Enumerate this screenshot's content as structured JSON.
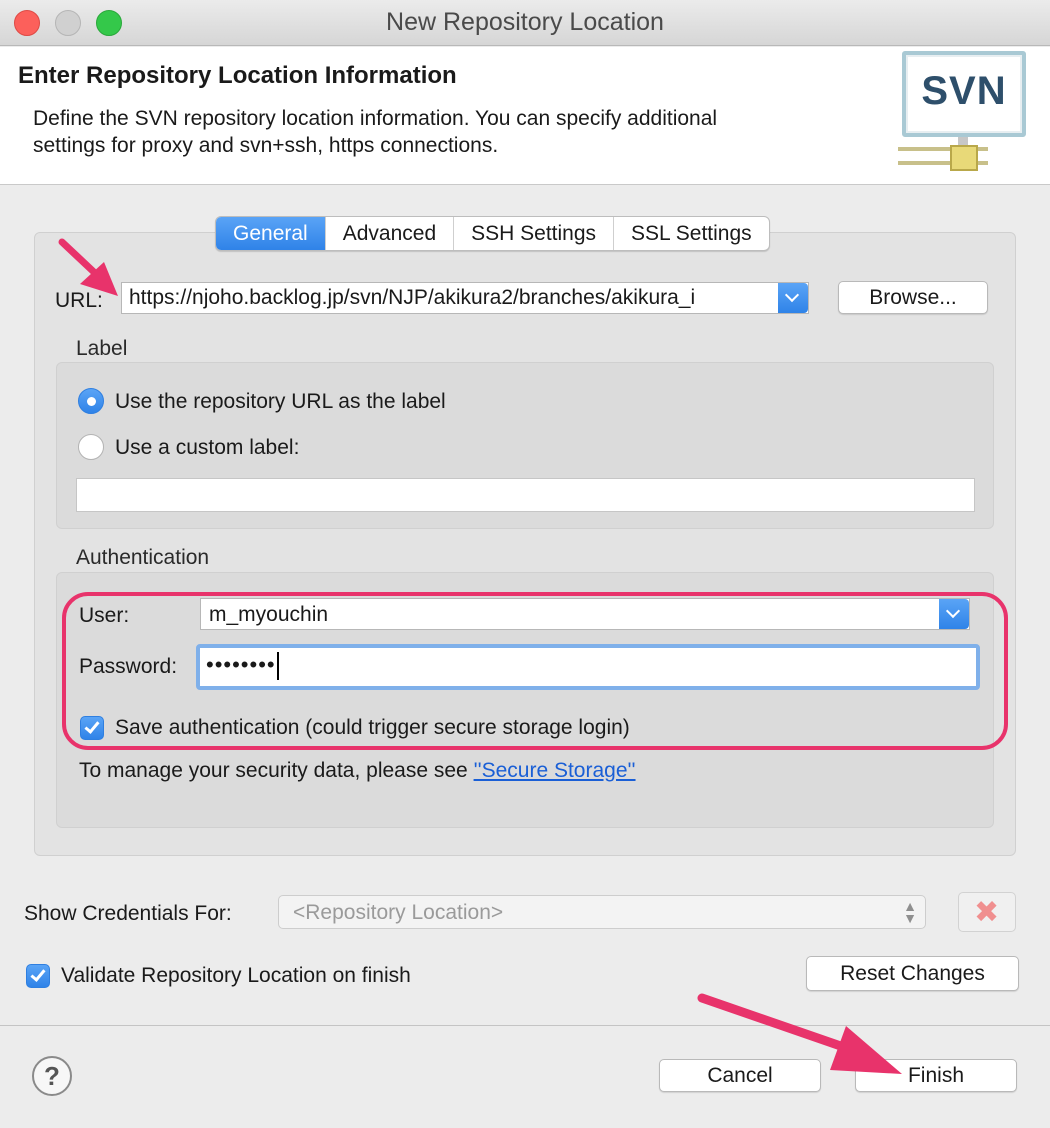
{
  "window": {
    "title": "New Repository Location"
  },
  "header": {
    "title": "Enter Repository Location Information",
    "description": "Define the SVN repository location information. You can specify additional settings for proxy and svn+ssh, https connections.",
    "logo_text": "SVN"
  },
  "tabs": [
    {
      "label": "General",
      "active": true
    },
    {
      "label": "Advanced",
      "active": false
    },
    {
      "label": "SSH Settings",
      "active": false
    },
    {
      "label": "SSL Settings",
      "active": false
    }
  ],
  "url": {
    "label": "URL:",
    "value": "https://njoho.backlog.jp/svn/NJP/akikura2/branches/akikura_i",
    "browse_label": "Browse..."
  },
  "label_group": {
    "caption": "Label",
    "option_repo_url": "Use the repository URL as the label",
    "option_custom": "Use a custom label:",
    "selected": "option_repo_url",
    "custom_value": ""
  },
  "auth": {
    "caption": "Authentication",
    "user_label": "User:",
    "user_value": "m_myouchin",
    "password_label": "Password:",
    "password_value": "••••••••",
    "save_label": "Save authentication (could trigger secure storage login)",
    "save_checked": true,
    "manage_text": "To manage your security data, please see ",
    "secure_storage_link": "''Secure Storage''"
  },
  "credentials": {
    "label": "Show Credentials For:",
    "placeholder": "<Repository Location>"
  },
  "validate": {
    "label": "Validate Repository Location on finish",
    "checked": true
  },
  "buttons": {
    "reset": "Reset Changes",
    "cancel": "Cancel",
    "finish": "Finish",
    "help": "?"
  },
  "colors": {
    "accent": "#2f83e8",
    "annotation": "#e8336b",
    "link": "#1a5fd6"
  }
}
